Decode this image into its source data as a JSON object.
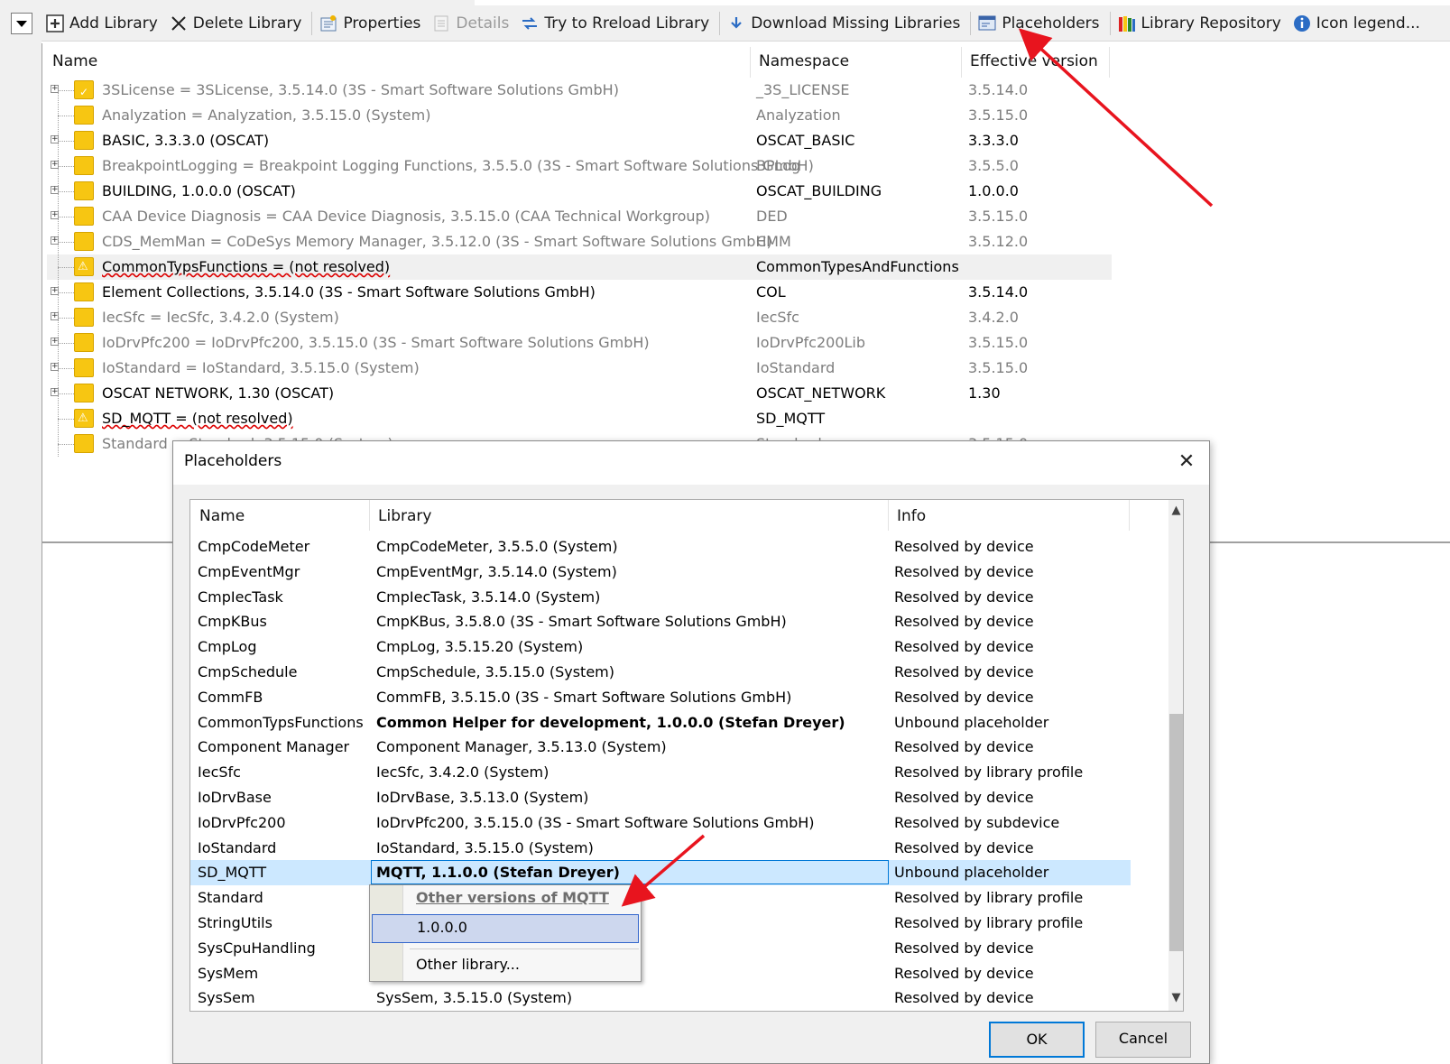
{
  "toolbar": {
    "add_library": "Add Library",
    "delete_library": "Delete Library",
    "properties": "Properties",
    "details": "Details",
    "try_reload": "Try to Rreload Library",
    "download_missing": "Download Missing Libraries",
    "placeholders": "Placeholders",
    "library_repository": "Library Repository",
    "icon_legend": "Icon legend..."
  },
  "tree": {
    "columns": [
      "Name",
      "Namespace",
      "Effective version"
    ],
    "rows": [
      {
        "name": "3SLicense = 3SLicense, 3.5.14.0 (3S - Smart Software Solutions GmbH)",
        "namespace": "_3S_LICENSE",
        "version": "3.5.14.0",
        "style": "grey",
        "icon": "license-icon",
        "expand": true
      },
      {
        "name": "Analyzation = Analyzation, 3.5.15.0 (System)",
        "namespace": "Analyzation",
        "version": "3.5.15.0",
        "style": "grey",
        "icon": "library-icon",
        "expand": false
      },
      {
        "name": "BASIC, 3.3.3.0 (OSCAT)",
        "namespace": "OSCAT_BASIC",
        "version": "3.3.3.0",
        "style": "black",
        "icon": "library-icon",
        "expand": true
      },
      {
        "name": "BreakpointLogging = Breakpoint Logging Functions, 3.5.5.0 (3S - Smart Software Solutions GmbH)",
        "namespace": "BPLog",
        "version": "3.5.5.0",
        "style": "grey",
        "icon": "library-icon",
        "expand": true
      },
      {
        "name": "BUILDING, 1.0.0.0 (OSCAT)",
        "namespace": "OSCAT_BUILDING",
        "version": "1.0.0.0",
        "style": "black",
        "icon": "library-icon",
        "expand": true
      },
      {
        "name": "CAA Device Diagnosis = CAA Device Diagnosis, 3.5.15.0 (CAA Technical Workgroup)",
        "namespace": "DED",
        "version": "3.5.15.0",
        "style": "grey",
        "icon": "library-icon",
        "expand": true
      },
      {
        "name": "CDS_MemMan = CoDeSys Memory Manager, 3.5.12.0 (3S - Smart Software Solutions GmbH)",
        "namespace": "CMM",
        "version": "3.5.12.0",
        "style": "grey",
        "icon": "library-icon",
        "expand": true
      },
      {
        "name": "CommonTypsFunctions = (not resolved)",
        "namespace": "CommonTypesAndFunctions",
        "version": "",
        "style": "warn",
        "icon": "warning-library-icon",
        "expand": false
      },
      {
        "name": "Element Collections, 3.5.14.0 (3S - Smart Software Solutions GmbH)",
        "namespace": "COL",
        "version": "3.5.14.0",
        "style": "black",
        "icon": "library-icon",
        "expand": true
      },
      {
        "name": "IecSfc = IecSfc, 3.4.2.0 (System)",
        "namespace": "IecSfc",
        "version": "3.4.2.0",
        "style": "grey",
        "icon": "library-icon",
        "expand": true
      },
      {
        "name": "IoDrvPfc200 = IoDrvPfc200, 3.5.15.0 (3S - Smart Software Solutions GmbH)",
        "namespace": "IoDrvPfc200Lib",
        "version": "3.5.15.0",
        "style": "grey",
        "icon": "library-icon",
        "expand": true
      },
      {
        "name": "IoStandard = IoStandard, 3.5.15.0 (System)",
        "namespace": "IoStandard",
        "version": "3.5.15.0",
        "style": "grey",
        "icon": "library-icon",
        "expand": true
      },
      {
        "name": "OSCAT NETWORK, 1.30 (OSCAT)",
        "namespace": "OSCAT_NETWORK",
        "version": "1.30",
        "style": "black",
        "icon": "library-icon",
        "expand": true
      },
      {
        "name": "SD_MQTT = (not resolved)",
        "namespace": "SD_MQTT",
        "version": "",
        "style": "warn",
        "icon": "warning-library-icon",
        "expand": false
      },
      {
        "name": "Standard = Standard, 3.5.15.0 (System)",
        "namespace": "Standard",
        "version": "3.5.15.0",
        "style": "grey",
        "icon": "library-icon",
        "expand": false
      }
    ]
  },
  "dialog": {
    "title": "Placeholders",
    "columns": [
      "Name",
      "Library",
      "Info"
    ],
    "rows": [
      {
        "name": "CmpCodeMeter",
        "library": "CmpCodeMeter, 3.5.5.0 (System)",
        "info": "Resolved by device"
      },
      {
        "name": "CmpEventMgr",
        "library": "CmpEventMgr, 3.5.14.0 (System)",
        "info": "Resolved by device"
      },
      {
        "name": "CmpIecTask",
        "library": "CmpIecTask, 3.5.14.0 (System)",
        "info": "Resolved by device"
      },
      {
        "name": "CmpKBus",
        "library": "CmpKBus, 3.5.8.0 (3S - Smart Software Solutions GmbH)",
        "info": "Resolved by device"
      },
      {
        "name": "CmpLog",
        "library": "CmpLog, 3.5.15.20 (System)",
        "info": "Resolved by device"
      },
      {
        "name": "CmpSchedule",
        "library": "CmpSchedule, 3.5.15.0 (System)",
        "info": "Resolved by device"
      },
      {
        "name": "CommFB",
        "library": "CommFB, 3.5.15.0 (3S - Smart Software Solutions GmbH)",
        "info": "Resolved by device"
      },
      {
        "name": "CommonTypsFunctions",
        "library": "Common Helper for development, 1.0.0.0 (Stefan Dreyer)",
        "info": "Unbound placeholder",
        "bold": true
      },
      {
        "name": "Component Manager",
        "library": "Component Manager, 3.5.13.0 (System)",
        "info": "Resolved by device"
      },
      {
        "name": "IecSfc",
        "library": "IecSfc, 3.4.2.0 (System)",
        "info": "Resolved by library profile"
      },
      {
        "name": "IoDrvBase",
        "library": "IoDrvBase, 3.5.13.0 (System)",
        "info": "Resolved by device"
      },
      {
        "name": "IoDrvPfc200",
        "library": "IoDrvPfc200, 3.5.15.0 (3S - Smart Software Solutions GmbH)",
        "info": "Resolved by subdevice"
      },
      {
        "name": "IoStandard",
        "library": "IoStandard, 3.5.15.0 (System)",
        "info": "Resolved by device"
      },
      {
        "name": "SD_MQTT",
        "library": "MQTT, 1.1.0.0 (Stefan Dreyer)",
        "info": "Unbound placeholder",
        "bold": true,
        "selected": true
      },
      {
        "name": "Standard",
        "library": "",
        "info": "Resolved by library profile"
      },
      {
        "name": "StringUtils",
        "library": "",
        "info": "Resolved by library profile"
      },
      {
        "name": "SysCpuHandling",
        "library": "",
        "info": "Resolved by device"
      },
      {
        "name": "SysMem",
        "library": "",
        "info": "Resolved by device"
      },
      {
        "name": "SysSem",
        "library": "SysSem, 3.5.15.0 (System)",
        "info": "Resolved by device"
      }
    ],
    "ok_label": "OK",
    "cancel_label": "Cancel"
  },
  "popup": {
    "header": "Other versions of MQTT",
    "version_item": "1.0.0.0",
    "other_library": "Other library..."
  },
  "colors": {
    "annotation_arrow": "#e8141e",
    "selection": "#cce8ff",
    "library_icon": "#f7c612"
  }
}
